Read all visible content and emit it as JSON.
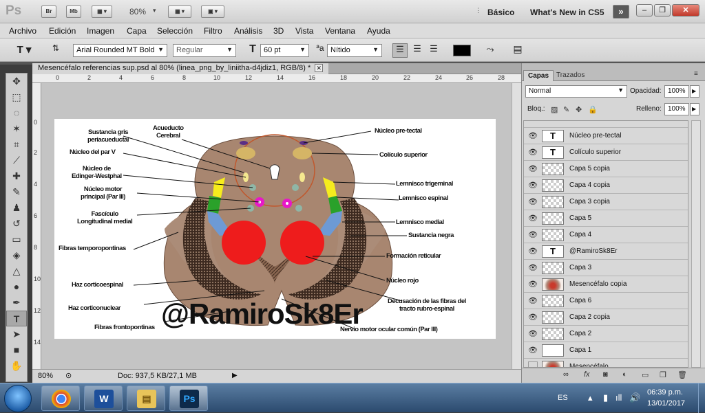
{
  "appbar": {
    "logo": "Ps",
    "zoom": "80%",
    "badges": [
      "Br",
      "Mb"
    ],
    "workspaces": [
      "Básico",
      "What's New in CS5"
    ]
  },
  "menu": [
    "Archivo",
    "Edición",
    "Imagen",
    "Capa",
    "Selección",
    "Filtro",
    "Análisis",
    "3D",
    "Vista",
    "Ventana",
    "Ayuda"
  ],
  "options": {
    "font_family": "Arial Rounded MT Bold",
    "font_style": "Regular",
    "font_size": "60 pt",
    "antialias": "Nítido",
    "color": "#000000"
  },
  "document": {
    "tab_title": "Mesencéfalo referencias sup.psd al 80% (linea_png_by_liniitha-d4jdiz1, RGB/8) *",
    "ruler_top": [
      "0",
      "2",
      "4",
      "6",
      "8",
      "10",
      "12",
      "14",
      "16",
      "18",
      "20",
      "22",
      "24",
      "26",
      "28"
    ],
    "ruler_left": [
      "0",
      "2",
      "4",
      "6",
      "8",
      "10",
      "12",
      "14"
    ],
    "status_zoom": "80%",
    "status_doc": "Doc: 937,5 KB/27,1 MB"
  },
  "figure": {
    "watermark": "@RamiroSk8Er",
    "labels": {
      "sustancia_gris": "Sustancia gris\nperiacueductal",
      "acueducto": "Acueducto\nCerebral",
      "nucleo_par_v": "Núcleo del par V",
      "edinger": "Núcleo de\nEdinger-Westphal",
      "nucleo_motor": "Núcleo motor\nprincipal (Par III)",
      "fasciculo": "Fascículo\nLongitudinal medial",
      "fibras_tempo": "Fibras temporopontinas",
      "haz_cortico_esp": "Haz corticoespinal",
      "haz_cortico_nuc": "Haz corticonuclear",
      "fibras_fronto": "Fibras frontopontinas",
      "nucleo_pretectal": "Núcleo pre-tectal",
      "coliculo": "Colículo superior",
      "lemnisco_trig": "Lemnisco trigeminal",
      "lemnisco_esp": "Lemnisco espinal",
      "lemnisco_med": "Lemnisco medial",
      "sustancia_negra": "Sustancia negra",
      "formacion_ret": "Formación reticular",
      "nucleo_rojo": "Núcleo rojo",
      "decusacion": "Decusación de las fibras del\ntracto rubro-espinal",
      "nervio_motor": "Nervio motor ocular común (Par III)"
    }
  },
  "panel": {
    "tabs": [
      "Capas",
      "Trazados"
    ],
    "blend_mode": "Normal",
    "opacity_label": "Opacidad:",
    "opacity": "100%",
    "lock_label": "Bloq.:",
    "fill_label": "Relleno:",
    "fill": "100%",
    "layers": [
      {
        "name": "Núcleo pre-tectal",
        "type": "text",
        "visible": true
      },
      {
        "name": "Colículo superior",
        "type": "text",
        "visible": true
      },
      {
        "name": "Capa 5 copia",
        "type": "transparent",
        "visible": true
      },
      {
        "name": "Capa 4 copia",
        "type": "transparent",
        "visible": true
      },
      {
        "name": "Capa 3 copia",
        "type": "transparent",
        "visible": true
      },
      {
        "name": "Capa 5",
        "type": "transparent",
        "visible": true
      },
      {
        "name": "Capa 4",
        "type": "transparent",
        "visible": true
      },
      {
        "name": "@RamiroSk8Er",
        "type": "text",
        "visible": true
      },
      {
        "name": "Capa 3",
        "type": "transparent",
        "visible": true
      },
      {
        "name": "Mesencéfalo copia",
        "type": "image",
        "visible": true
      },
      {
        "name": "Capa 6",
        "type": "transparent",
        "visible": true
      },
      {
        "name": "Capa 2 copia",
        "type": "transparent",
        "visible": true
      },
      {
        "name": "Capa 2",
        "type": "transparent",
        "visible": true
      },
      {
        "name": "Capa 1",
        "type": "white",
        "visible": true
      },
      {
        "name": "Mesencéfalo",
        "type": "image",
        "visible": false
      }
    ]
  },
  "taskbar": {
    "lang": "ES",
    "time": "06:39 p.m.",
    "date": "13/01/2017",
    "apps": [
      "chrome-icon",
      "word-icon",
      "explorer-icon",
      "photoshop-icon"
    ]
  }
}
